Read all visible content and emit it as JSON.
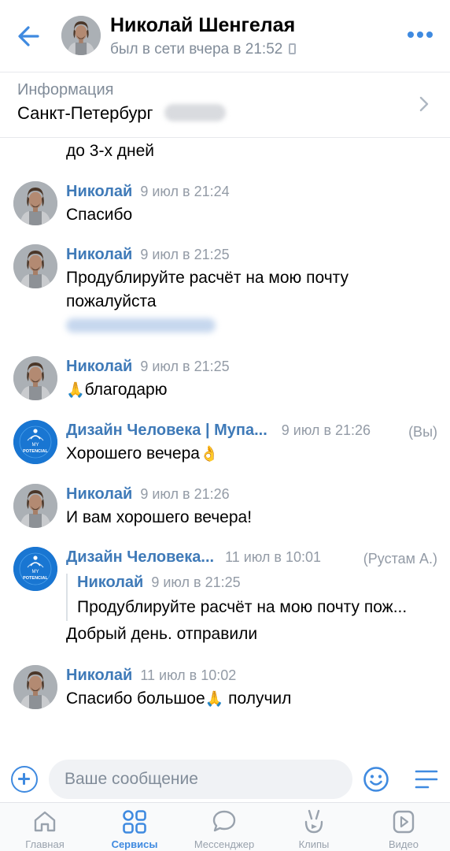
{
  "header": {
    "name": "Николай Шенгелая",
    "status": "был в сети вчера в 21:52"
  },
  "info": {
    "label": "Информация",
    "city": "Санкт-Петербург"
  },
  "messages": [
    {
      "text": "до 3-х дней"
    },
    {
      "author": "Николай",
      "time": "9 июл в 21:24",
      "text": "Спасибо"
    },
    {
      "author": "Николай",
      "time": "9 июл в 21:25",
      "text": "Продублируйте расчёт на мою почту пожалуйста"
    },
    {
      "author": "Николай",
      "time": "9 июл в 21:25",
      "text": "благодарю"
    },
    {
      "author": "Дизайн Человека | Mупа...",
      "time": "9 июл в 21:26",
      "extra": "(Вы)",
      "text": "Хорошего вечера"
    },
    {
      "author": "Николай",
      "time": "9 июл в 21:26",
      "text": "И вам хорошего вечера!"
    },
    {
      "author": "Дизайн Человека...",
      "time": "11 июл в 10:01",
      "extra": "(Рустам А.)",
      "reply": {
        "author": "Николай",
        "time": "9 июл в 21:25",
        "text": "Продублируйте расчёт на мою почту пож..."
      },
      "text": "Добрый день. отправили"
    },
    {
      "author": "Николай",
      "time": "11 июл в 10:02",
      "text_a": "Спасибо большое",
      "text_b": " получил"
    }
  ],
  "composer": {
    "placeholder": "Ваше сообщение"
  },
  "tabs": [
    {
      "label": "Главная",
      "icon": "home-icon"
    },
    {
      "label": "Сервисы",
      "icon": "services-icon",
      "active": true
    },
    {
      "label": "Мессенджер",
      "icon": "chat-icon"
    },
    {
      "label": "Клипы",
      "icon": "clips-icon"
    },
    {
      "label": "Видео",
      "icon": "video-icon"
    }
  ],
  "avatar_logo_text": {
    "line1": "MY",
    "line2": "POTENCIAL"
  },
  "colors": {
    "accent": "#3f8ae0",
    "name": "#3f7ab8",
    "meta": "#939ba6"
  }
}
